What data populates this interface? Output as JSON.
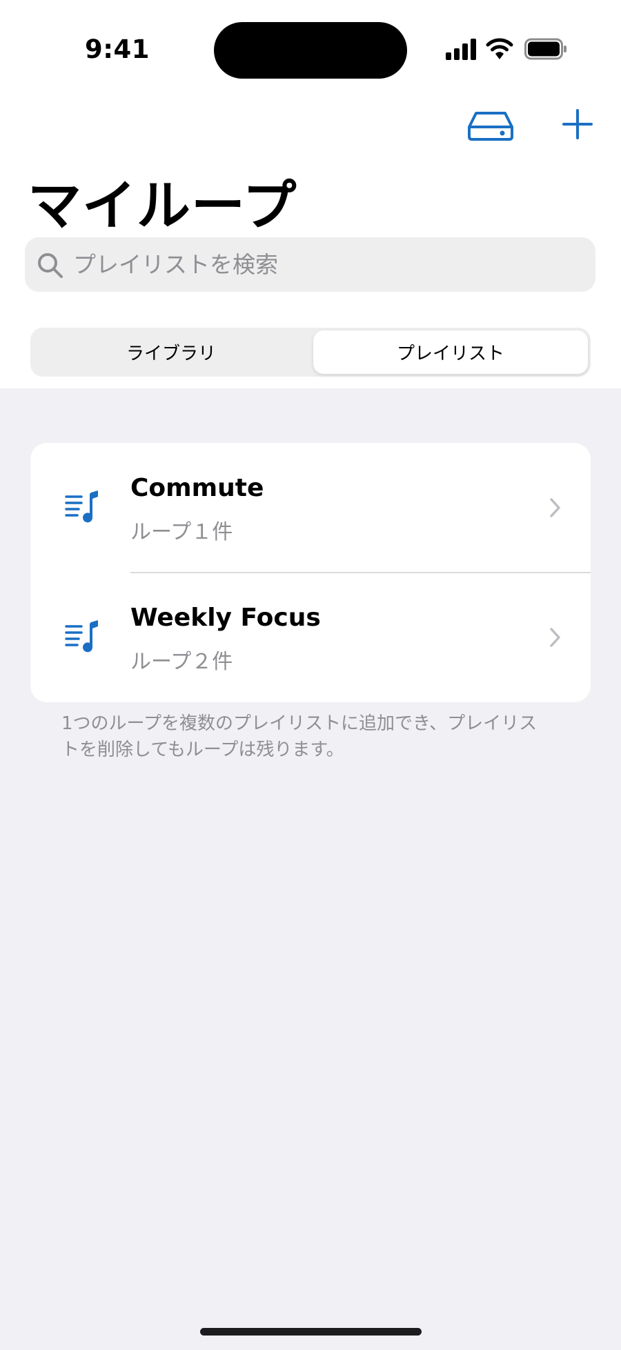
{
  "status_bar": {
    "time": "9:41"
  },
  "toolbar": {
    "storage_icon": "storage-drive-icon",
    "add_icon": "plus-icon"
  },
  "page": {
    "title": "マイループ"
  },
  "search": {
    "placeholder": "プレイリストを検索",
    "value": ""
  },
  "segments": {
    "items": [
      {
        "label": "ライブラリ",
        "selected": false
      },
      {
        "label": "プレイリスト",
        "selected": true
      }
    ]
  },
  "playlists": {
    "items": [
      {
        "title": "Commute",
        "subtitle": "ループ１件",
        "icon": "music-list-icon"
      },
      {
        "title": "Weekly Focus",
        "subtitle": "ループ２件",
        "icon": "music-list-icon"
      }
    ]
  },
  "footnote": "1つのループを複数のプレイリストに追加でき、プレイリストを削除してもループは残ります。",
  "colors": {
    "accent": "#1A6FC4",
    "background": "#F0F0F5",
    "secondary_text": "#8E8E93"
  }
}
